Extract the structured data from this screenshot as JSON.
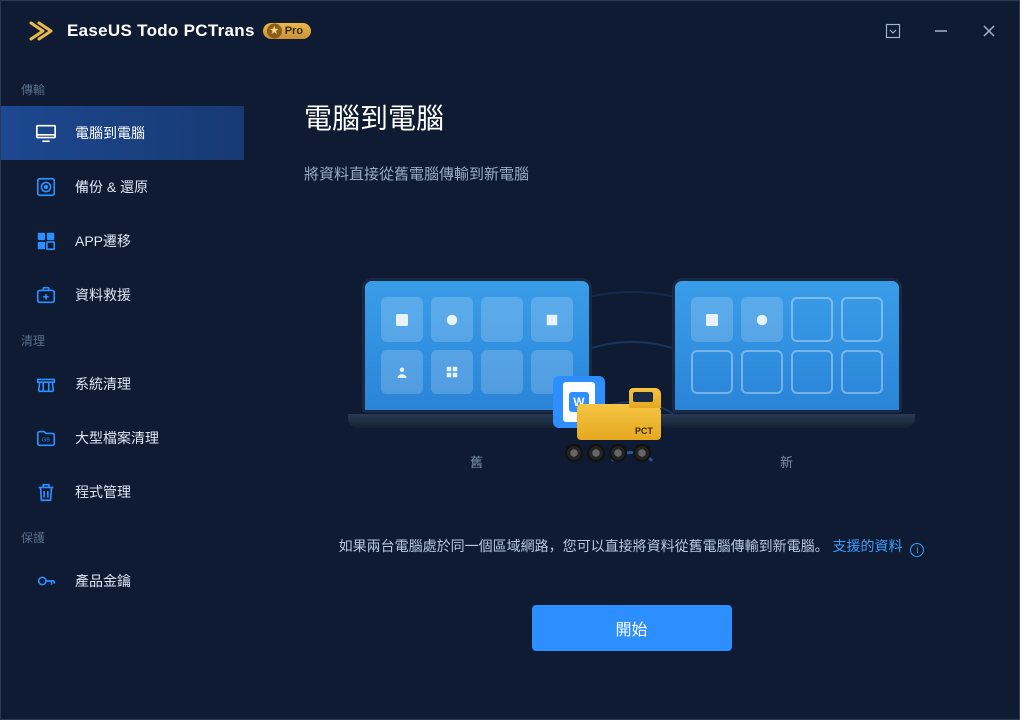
{
  "app": {
    "title": "EaseUS Todo PCTrans",
    "badge": "Pro"
  },
  "sidebar": {
    "sections": [
      {
        "label": "傳輸",
        "items": [
          {
            "label": "電腦到電腦",
            "icon": "monitor-icon",
            "active": true
          },
          {
            "label": "備份 & 還原",
            "icon": "disc-icon"
          },
          {
            "label": "APP遷移",
            "icon": "apps-icon"
          },
          {
            "label": "資料救援",
            "icon": "medkit-icon"
          }
        ]
      },
      {
        "label": "清理",
        "items": [
          {
            "label": "系統清理",
            "icon": "broom-icon"
          },
          {
            "label": "大型檔案清理",
            "icon": "folder-gb-icon"
          },
          {
            "label": "程式管理",
            "icon": "trash-icon"
          }
        ]
      },
      {
        "label": "保護",
        "items": [
          {
            "label": "產品金鑰",
            "icon": "key-icon"
          }
        ]
      }
    ]
  },
  "main": {
    "title": "電腦到電腦",
    "subtitle": "將資料直接從舊電腦傳輸到新電腦",
    "old_label": "舊",
    "new_label": "新",
    "truck_label": "PCT",
    "description_pre": "如果兩台電腦處於同一個區域網路，您可以直接將資料從舊電腦傳輸到新電腦。",
    "description_link": "支援的資料",
    "start_label": "開始"
  }
}
